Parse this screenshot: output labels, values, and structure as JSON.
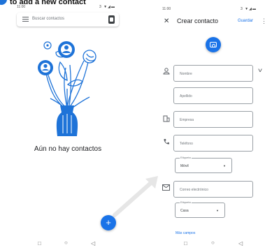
{
  "banner": {
    "text": "to add a new contact"
  },
  "left": {
    "status_time": "11:00",
    "status_icons": "3 ▼◢▬",
    "search_placeholder": "Buscar contactos",
    "empty_message": "Aún no hay contactos",
    "fab_label": "+"
  },
  "right": {
    "status_time": "11:00",
    "status_icons": "3 ▼◢▬",
    "close_label": "✕",
    "title": "Crear contacto",
    "save_label": "Guardar",
    "menu_label": "⋮",
    "fields": {
      "first_name": "Nombre",
      "last_name": "Apellido",
      "company": "Empresa",
      "phone": "Teléfono",
      "email": "Correo electrónico"
    },
    "phone_type": {
      "label": "Etiqueta",
      "value": "Móvil"
    },
    "email_type": {
      "label": "Etiqueta",
      "value": "Casa"
    },
    "more_fields": "Más campos"
  },
  "nav": {
    "back": "◁",
    "home": "○",
    "recents": "□"
  },
  "colors": {
    "accent": "#1a73e8",
    "illustration": "#1e73d8"
  }
}
